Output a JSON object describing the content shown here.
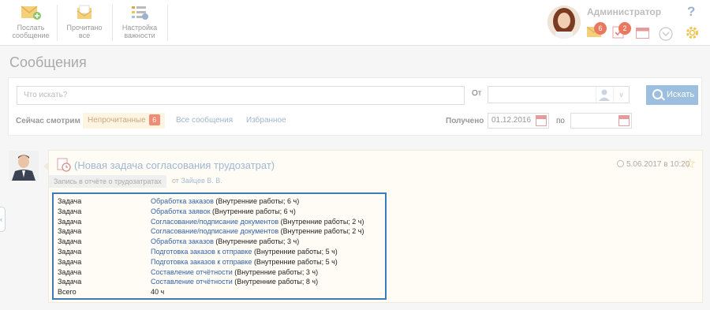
{
  "toolbar": {
    "send_label_1": "Послать",
    "send_label_2": "сообщение",
    "read_label_1": "Прочитано",
    "read_label_2": "все",
    "importance_label_1": "Настройка",
    "importance_label_2": "важности"
  },
  "user": {
    "name": "Администратор",
    "help": "?",
    "notifications": [
      {
        "icon": "envelope-icon",
        "count": "6"
      },
      {
        "icon": "task-icon",
        "count": "2"
      }
    ]
  },
  "page": {
    "title": "Сообщения"
  },
  "filter": {
    "search_placeholder": "Что искать?",
    "from_label": "От",
    "search_button": "Искать",
    "viewing_label": "Сейчас смотрим",
    "chips": [
      {
        "label": "Непрочитанные",
        "count": "6",
        "active": true
      },
      {
        "label": "Все сообщения"
      },
      {
        "label": "Избранное"
      }
    ],
    "received_label": "Получено",
    "date_from": "01.12.2016",
    "to_label": "по",
    "date_to": ""
  },
  "message": {
    "title": "(Новая задача согласования трудозатрат)",
    "date": "5.06.2017 в 10:20",
    "tag": "Запись в отчёте о трудозатратах",
    "from_prefix": "от",
    "from_name": "Зайцев В. В.",
    "rows": [
      {
        "type": "Задача",
        "link": "Обработка заказов",
        "detail": " (Внутренние работы; 6 ч)"
      },
      {
        "type": "Задача",
        "link": "Обработка заявок",
        "detail": " (Внутренние работы; 6 ч)"
      },
      {
        "type": "Задача",
        "link": "Согласование/подписание документов",
        "detail": " (Внутренние работы; 2 ч)"
      },
      {
        "type": "Задача",
        "link": "Согласование/подписание документов",
        "detail": " (Внутренние работы; 2 ч)"
      },
      {
        "type": "Задача",
        "link": "Обработка заказов",
        "detail": " (Внутренние работы; 3 ч)"
      },
      {
        "type": "Задача",
        "link": "Подготовка заказов к отправке",
        "detail": " (Внутренние работы; 5 ч)"
      },
      {
        "type": "Задача",
        "link": "Подготовка заказов к отправке",
        "detail": " (Внутренние работы; 5 ч)"
      },
      {
        "type": "Задача",
        "link": "Составление отчётности",
        "detail": " (Внутренние работы; 3 ч)"
      },
      {
        "type": "Задача",
        "link": "Составление отчётности",
        "detail": " (Внутренние работы; 8 ч)"
      }
    ],
    "total_label": "Всего",
    "total_value": "40 ч"
  },
  "colors": {
    "accent": "#9cbfdf",
    "link": "#3462a6",
    "badge": "#e8785f",
    "highlight_border": "#3c7db8"
  }
}
